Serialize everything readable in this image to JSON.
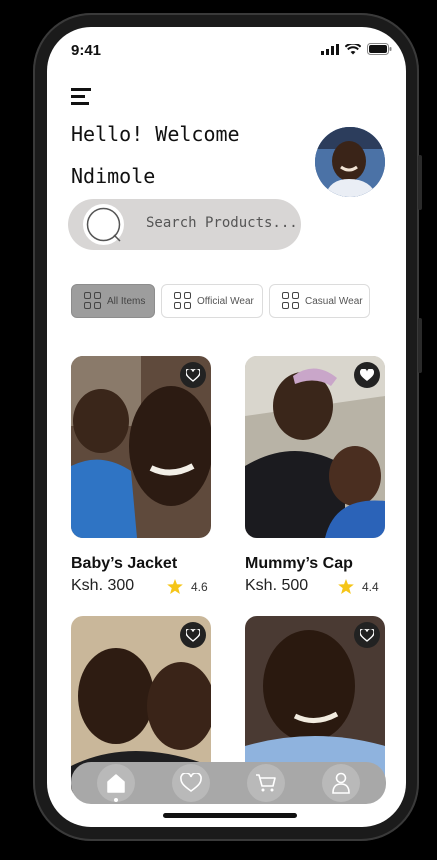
{
  "status": {
    "time": "9:41"
  },
  "greeting": {
    "line1": "Hello! Welcome",
    "line2": "Ndimole"
  },
  "search": {
    "placeholder": "Search Products..."
  },
  "filters": [
    {
      "label": "All Items",
      "active": true
    },
    {
      "label": "Official Wear",
      "active": false
    },
    {
      "label": "Casual Wear",
      "active": false
    }
  ],
  "products": [
    {
      "name": "Baby’s Jacket",
      "price": "Ksh. 300",
      "rating": "4.6"
    },
    {
      "name": "Mummy’s Cap",
      "price": "Ksh. 500",
      "rating": "4.4"
    },
    {
      "name": "",
      "price": "",
      "rating": ""
    },
    {
      "name": "",
      "price": "",
      "rating": ""
    }
  ],
  "nav": [
    "home-icon",
    "heart-icon",
    "cart-icon",
    "profile-icon"
  ],
  "colors": {
    "star": "#f5c518",
    "chip_active": "#9d9d9d",
    "navbar": "#a8a8a8"
  }
}
